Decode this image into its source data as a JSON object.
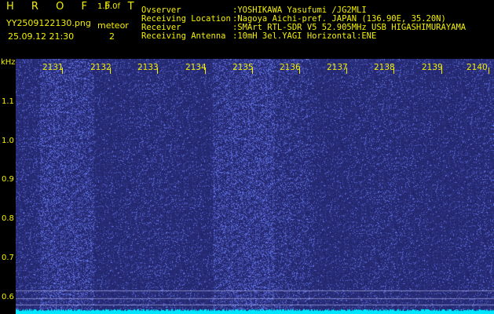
{
  "header": {
    "brand": "H R O F F T",
    "version": "1.0.0f",
    "filename": "YY2509122130.png",
    "datetime": "25.09.12 21:30",
    "meteor_label": "meteor",
    "meteor_count": "2",
    "fields": [
      {
        "label": "Ovserver",
        "value": ":YOSHIKAWA Yasufumi /JG2MLI"
      },
      {
        "label": "Receiving Location",
        "value": ":Nagoya Aichi-pref. JAPAN (136.90E, 35.20N)"
      },
      {
        "label": "Receiver",
        "value": ":SMArt RTL-SDR V5 52.905MHz USB HIGASHIMURAYAMA"
      },
      {
        "label": "Receiving Antenna",
        "value": ":10mH 3el.YAGI Horizontal:ENE"
      }
    ]
  },
  "axis": {
    "y_unit": "kHz",
    "y_ticks": [
      "1.1",
      "1.0",
      "0.9",
      "0.8",
      "0.7",
      "0.6"
    ],
    "x_ticks": [
      "2131",
      "2132",
      "2133",
      "2134",
      "2135",
      "2136",
      "2137",
      "2138",
      "2139",
      "2140"
    ]
  },
  "colors": {
    "text": "#f4f000",
    "background": "#000000",
    "spectrum_base": "#0c0c55",
    "noise_bright": "#6a78ff",
    "signal_line": "#00ffff"
  }
}
